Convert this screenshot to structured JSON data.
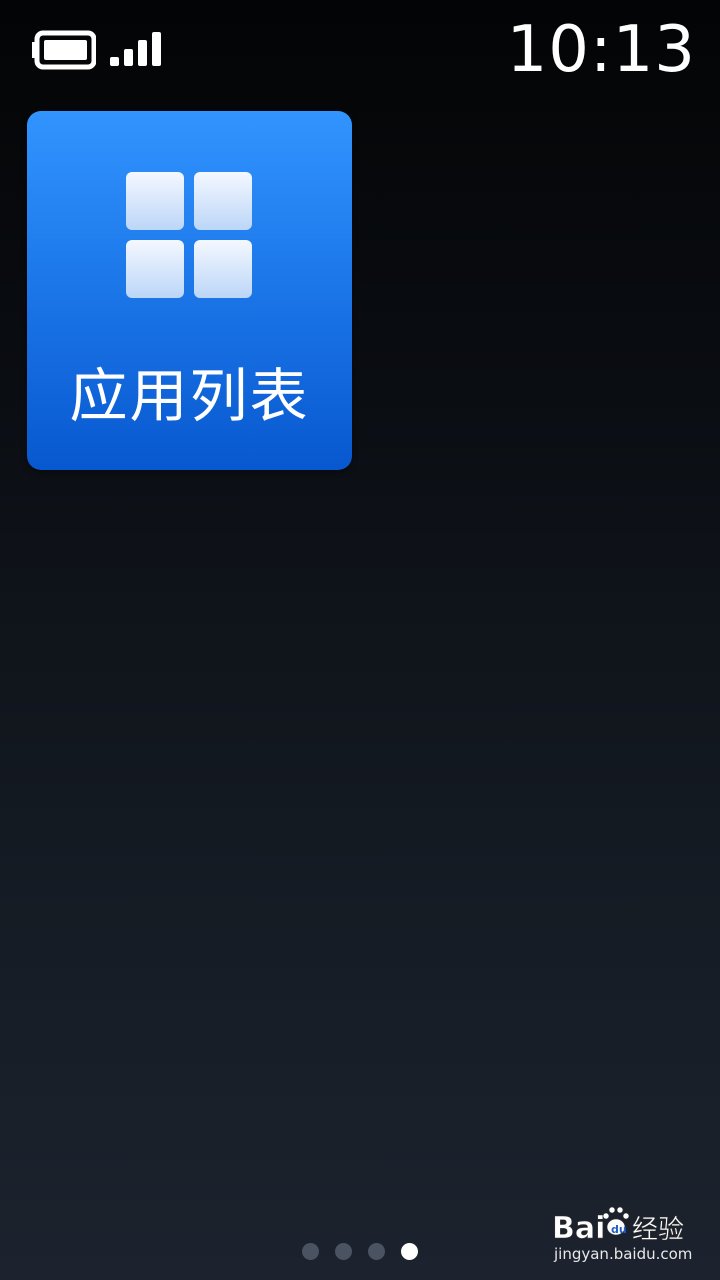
{
  "status_bar": {
    "time": "10:13",
    "battery_icon": "battery-icon",
    "signal_icon": "signal-strength-icon"
  },
  "home": {
    "tile": {
      "label": "应用列表",
      "icon": "app-grid-icon",
      "color": "#1d79ea"
    }
  },
  "pager": {
    "pages": 4,
    "current_page": 4
  },
  "watermark": {
    "logo_text": "Bai经验",
    "url": "jingyan.baidu.com"
  }
}
